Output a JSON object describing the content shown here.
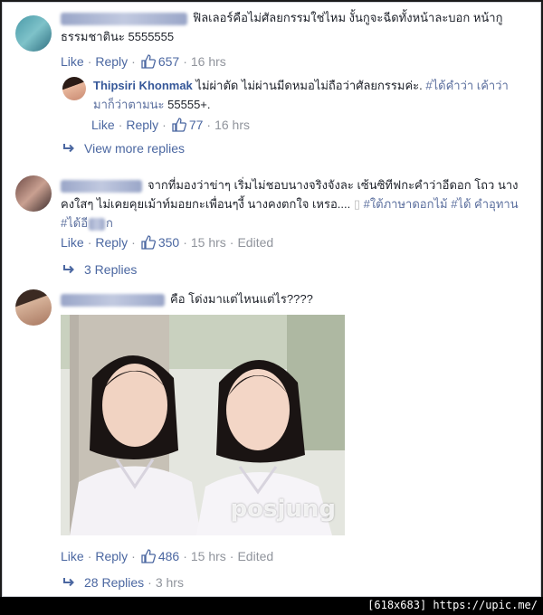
{
  "comments": [
    {
      "text": "ฟิลเลอร์คือไม่ศัลยกรรมใช่ไหม งั้นกูจะฉีดทั้งหน้าละบอก หน้ากู ธรรมชาตินะ 5555555",
      "like_label": "Like",
      "reply_label": "Reply",
      "likes": "657",
      "time": "16 hrs",
      "reply": {
        "author": "Thipsiri Khonmak",
        "text_plain": "ไม่ผ่าตัด ไม่ผ่านมีดหมอไม่ถือว่าศัลยกรรมค่ะ.",
        "tag": "#ได้คำว่า เค้าว่ามาก็ว่าตามนะ",
        "text_tail": "55555+.",
        "like_label": "Like",
        "reply_label": "Reply",
        "likes": "77",
        "time": "16 hrs"
      },
      "more_label": "View more replies"
    },
    {
      "text_plain": "จากที่มองว่าข่าๆ เริ่มไม่ชอบนางจริงจังละ เซ้นซิทีฟกะคำว่าอีดอก โถว นางคงใสๆ ไม่เคยคุยเม้าท์มอยกะเพื่อนๆงี้ นางคงตกใจ เหรอ....",
      "tags": "#ใต้ภาษาดอกไม้ #ได้ คำอุทาน #ได้อี",
      "tag_tail": "ก",
      "like_label": "Like",
      "reply_label": "Reply",
      "likes": "350",
      "time": "15 hrs",
      "edited": "Edited",
      "more_label": "3 Replies"
    },
    {
      "text": "คือ โด่งมาแต่ไหนแต่ไร????",
      "photo_watermark": "posjung",
      "like_label": "Like",
      "reply_label": "Reply",
      "likes": "486",
      "time": "15 hrs",
      "edited": "Edited",
      "more_label": "28 Replies",
      "more_time": "3 hrs"
    }
  ],
  "footer": "[618x683] https://upic.me/",
  "colors": {
    "link": "#4b67a1",
    "name": "#365899",
    "muted": "#90949c",
    "tag": "#5b6f9e"
  }
}
